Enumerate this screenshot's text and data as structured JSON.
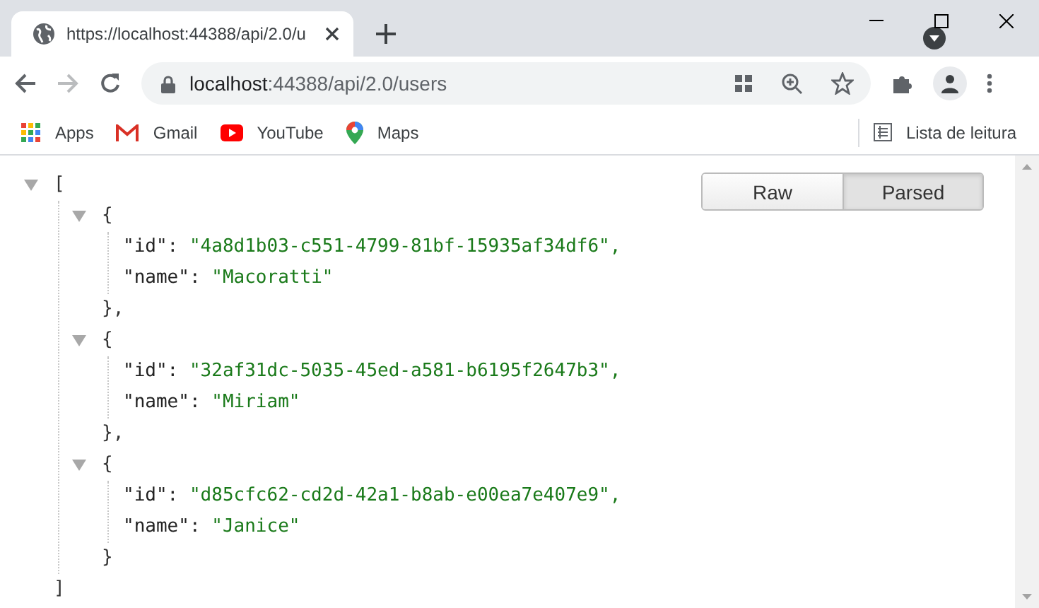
{
  "tab": {
    "title": "https://localhost:44388/api/2.0/u"
  },
  "address_bar": {
    "host": "localhost",
    "path": ":44388/api/2.0/users"
  },
  "bookmarks": [
    {
      "kind": "apps",
      "label": "Apps"
    },
    {
      "kind": "gmail",
      "label": "Gmail"
    },
    {
      "kind": "youtube",
      "label": "YouTube"
    },
    {
      "kind": "maps",
      "label": "Maps"
    }
  ],
  "reading_list": {
    "label": "Lista de leitura"
  },
  "view_toggle": [
    {
      "label": "Raw",
      "selected": false
    },
    {
      "label": "Parsed",
      "selected": true
    }
  ],
  "json_tree": {
    "open": "[",
    "close": "]",
    "expanded": true,
    "items": [
      {
        "open": "{",
        "close": "},",
        "expanded": true,
        "properties": [
          {
            "key": "\"id\":",
            "value": "\"4a8d1b03-c551-4799-81bf-15935af34df6\","
          },
          {
            "key": "\"name\":",
            "value": "\"Macoratti\""
          }
        ]
      },
      {
        "open": "{",
        "close": "},",
        "expanded": true,
        "properties": [
          {
            "key": "\"id\":",
            "value": "\"32af31dc-5035-45ed-a581-b6195f2647b3\","
          },
          {
            "key": "\"name\":",
            "value": "\"Miriam\""
          }
        ]
      },
      {
        "open": "{",
        "close": "}",
        "expanded": true,
        "properties": [
          {
            "key": "\"id\":",
            "value": "\"d85cfc62-cd2d-42a1-b8ab-e00ea7e407e9\","
          },
          {
            "key": "\"name\":",
            "value": "\"Janice\""
          }
        ]
      }
    ]
  }
}
